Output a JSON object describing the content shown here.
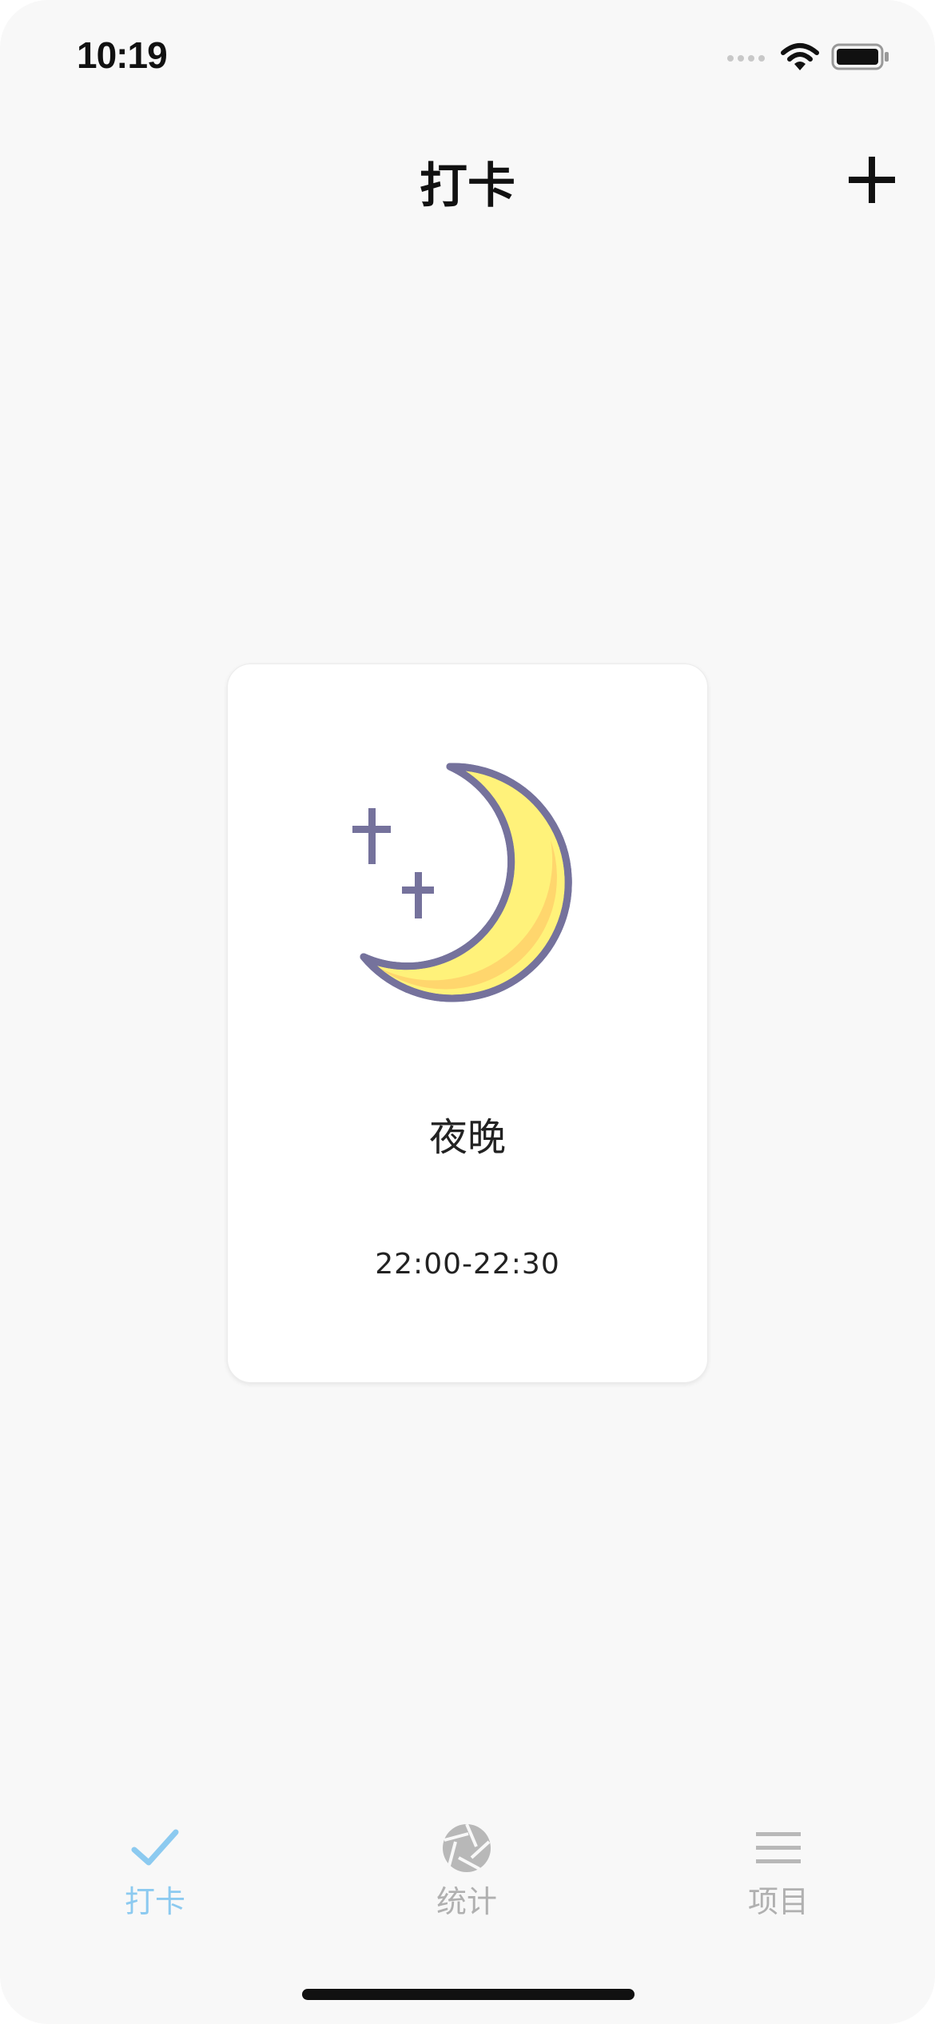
{
  "status_bar": {
    "time": "10:19"
  },
  "header": {
    "title": "打卡",
    "add_icon": "plus-icon"
  },
  "card": {
    "icon": "moon-icon",
    "title": "夜晚",
    "time_range": "22:00-22:30"
  },
  "tabs": [
    {
      "label": "打卡",
      "icon": "checkmark-icon",
      "active": true
    },
    {
      "label": "统计",
      "icon": "aperture-icon",
      "active": false
    },
    {
      "label": "项目",
      "icon": "list-icon",
      "active": false
    }
  ],
  "colors": {
    "active_tab": "#8ccaf0",
    "inactive_tab": "#b0b0b0",
    "moon_fill": "#fff27a",
    "moon_shade": "#ffd36b",
    "moon_stroke": "#75729c",
    "background": "#f8f8f8"
  }
}
